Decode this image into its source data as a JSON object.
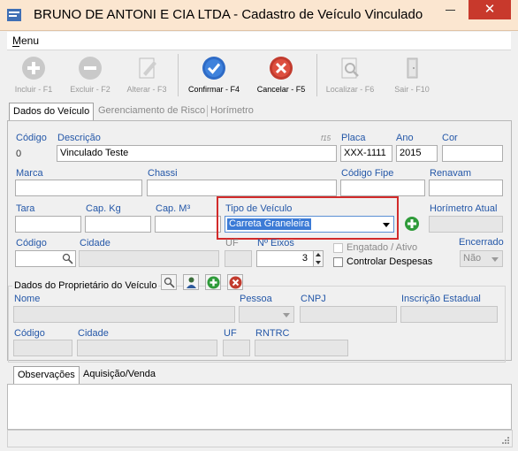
{
  "window": {
    "title": "BRUNO DE ANTONI E CIA LTDA - Cadastro de Veículo Vinculado",
    "close_glyph": "✕"
  },
  "menu": {
    "label": "Menu"
  },
  "toolbar": {
    "incluir": "Incluir - F1",
    "excluir": "Excluir - F2",
    "alterar": "Alterar - F3",
    "confirmar": "Confirmar - F4",
    "cancelar": "Cancelar - F5",
    "localizar": "Localizar - F6",
    "sair": "Sair - F10"
  },
  "tabs": [
    {
      "label": "Dados do Veículo"
    },
    {
      "label": "Gerenciamento de Risco"
    },
    {
      "label": "Horímetro"
    }
  ],
  "form": {
    "codigo_label": "Código",
    "codigo_value": "0",
    "descricao_label": "Descrição",
    "descricao_value": "Vinculado Teste",
    "f15_tag": "f15",
    "placa_label": "Placa",
    "placa_value": "XXX-1111",
    "ano_label": "Ano",
    "ano_value": "2015",
    "cor_label": "Cor",
    "marca_label": "Marca",
    "chassi_label": "Chassi",
    "codigo_fipe_label": "Código Fipe",
    "renavam_label": "Renavam",
    "tara_label": "Tara",
    "cap_kg_label": "Cap. Kg",
    "cap_m3_label": "Cap. M³",
    "tipo_veiculo_label": "Tipo de Veículo",
    "tipo_veiculo_value": "Carreta Graneleira",
    "horimetro_atual_label": "Horímetro Atual",
    "codigo2_label": "Código",
    "cidade_label": "Cidade",
    "uf_label": "UF",
    "n_eixos_label": "Nº Eixos",
    "n_eixos_value": "3",
    "engatado_label": "Engatado / Ativo",
    "controlar_despesas_label": "Controlar Despesas",
    "encerrado_label": "Encerrado",
    "encerrado_value": "Não"
  },
  "proprietario": {
    "group_label": "Dados do Proprietário do Veículo",
    "nome_label": "Nome",
    "pessoa_label": "Pessoa",
    "cnpj_label": "CNPJ",
    "inscricao_label": "Inscrição Estadual",
    "codigo_label": "Código",
    "cidade_label": "Cidade",
    "uf_label": "UF",
    "rntrc_label": "RNTRC"
  },
  "bottom_tabs": [
    {
      "label": "Observações"
    },
    {
      "label": "Aquisição/Venda"
    }
  ],
  "colors": {
    "label_blue": "#2457a8",
    "highlight_red": "#d22b2b",
    "selection_blue": "#3c7bd6",
    "titlebar_bg": "#fbe6d0",
    "close_red": "#c8392c"
  }
}
